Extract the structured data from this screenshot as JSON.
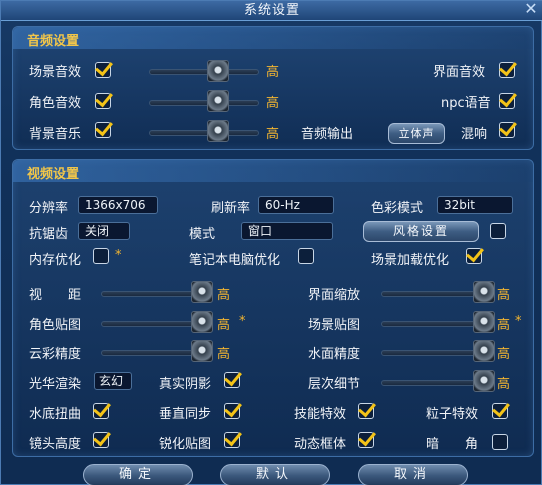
{
  "window": {
    "title": "系统设置",
    "close_glyph": "✕"
  },
  "audio": {
    "title": "音频设置",
    "scene_sound": "场景音效",
    "role_sound": "角色音效",
    "bg_music": "背景音乐",
    "high": "高",
    "ui_sound": "界面音效",
    "npc_voice": "npc语音",
    "output_label": "音频输出",
    "output_value": "立体声",
    "reverb": "混响",
    "scene_sound_level": 1,
    "role_sound_level": 1,
    "bg_music_level": 1
  },
  "video": {
    "title": "视频设置",
    "resolution_label": "分辨率",
    "resolution_value": "1366x706",
    "refresh_label": "刷新率",
    "refresh_value": "60-Hz",
    "color_label": "色彩模式",
    "color_value": "32bit",
    "aa_label": "抗锯齿",
    "aa_value": "关闭",
    "mode_label": "模式",
    "mode_value": "窗口",
    "style_button": "风格设置",
    "mem_opt": "内存优化",
    "laptop_opt": "笔记本电脑优化",
    "scene_load_opt": "场景加载优化",
    "view_dist": "视　　距",
    "ui_scale": "界面缩放",
    "role_tex": "角色贴图",
    "scene_tex": "场景贴图",
    "cloud": "云彩精度",
    "water": "水面精度",
    "bloom_label": "光华渲染",
    "bloom_value": "玄幻",
    "real_shadow": "真实阴影",
    "lod": "层次细节",
    "water_distort": "水底扭曲",
    "vsync": "垂直同步",
    "skill_fx": "技能特效",
    "particle_fx": "粒子特效",
    "cam_height": "镜头高度",
    "sharpen": "锐化贴图",
    "motion_frame": "动态框体",
    "dark_corner": "暗　　角",
    "high": "高",
    "star": "*",
    "quality_level": 1
  },
  "footer": {
    "ok": "确定",
    "default": "默认",
    "cancel": "取消"
  },
  "colors": {
    "accent": "#f2b531",
    "check": "#f3c318",
    "title": "#f1c64a"
  }
}
